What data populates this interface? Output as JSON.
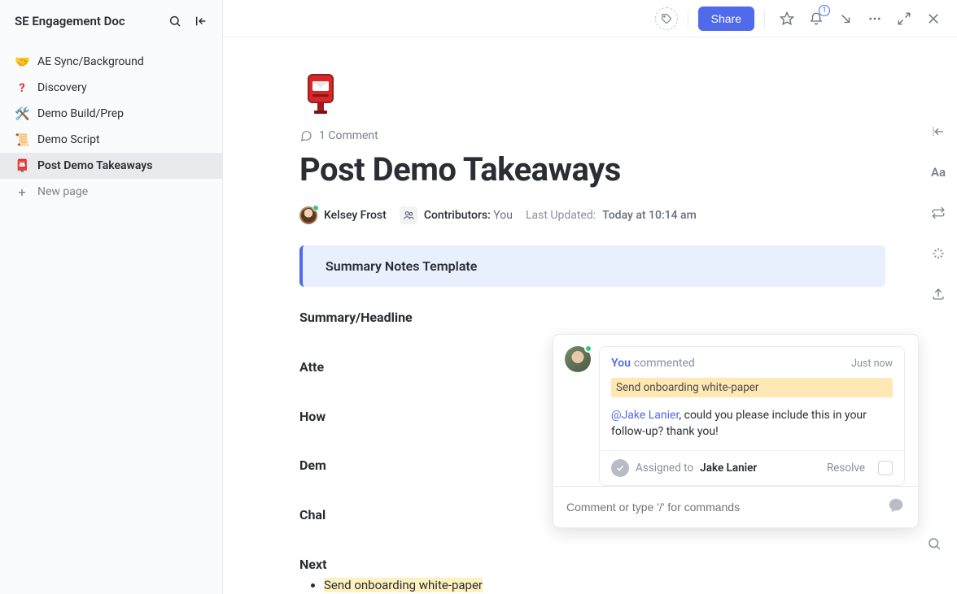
{
  "sidebar": {
    "title": "SE Engagement Doc",
    "items": [
      {
        "emoji": "🤝",
        "label": "AE Sync/Background"
      },
      {
        "emoji": "❓",
        "label": "Discovery",
        "emojiColor": "#d33"
      },
      {
        "emoji": "🛠️",
        "label": "Demo Build/Prep"
      },
      {
        "emoji": "📜",
        "label": "Demo Script"
      },
      {
        "emoji": "📮",
        "label": "Post Demo Takeaways",
        "active": true
      }
    ],
    "newPage": "New page"
  },
  "topbar": {
    "share": "Share",
    "notificationCount": "1"
  },
  "doc": {
    "commentCount": "1 Comment",
    "title": "Post Demo Takeaways",
    "owner": "Kelsey Frost",
    "contributorsLabel": "Contributors:",
    "contributorsValue": "You",
    "lastUpdatedLabel": "Last Updated:",
    "lastUpdatedValue": "Today at 10:14 am",
    "bannerTitle": "Summary Notes Template",
    "sections": [
      "Summary/Headline",
      "Atte",
      "How",
      "Dem",
      "Chal",
      "Next"
    ],
    "highlightedItem": "Send onboarding white-paper"
  },
  "comment": {
    "author": "You",
    "action": "commented",
    "time": "Just now",
    "quote": "Send onboarding white-paper",
    "mention": "@Jake Lanier",
    "body": ", could you please include this in your follow-up? thank you!",
    "assignedToLabel": "Assigned to",
    "assignedToName": "Jake Lanier",
    "resolve": "Resolve",
    "replyPlaceholder": "Comment or type '/' for commands"
  },
  "rightRail": {
    "aa": "Aa"
  }
}
